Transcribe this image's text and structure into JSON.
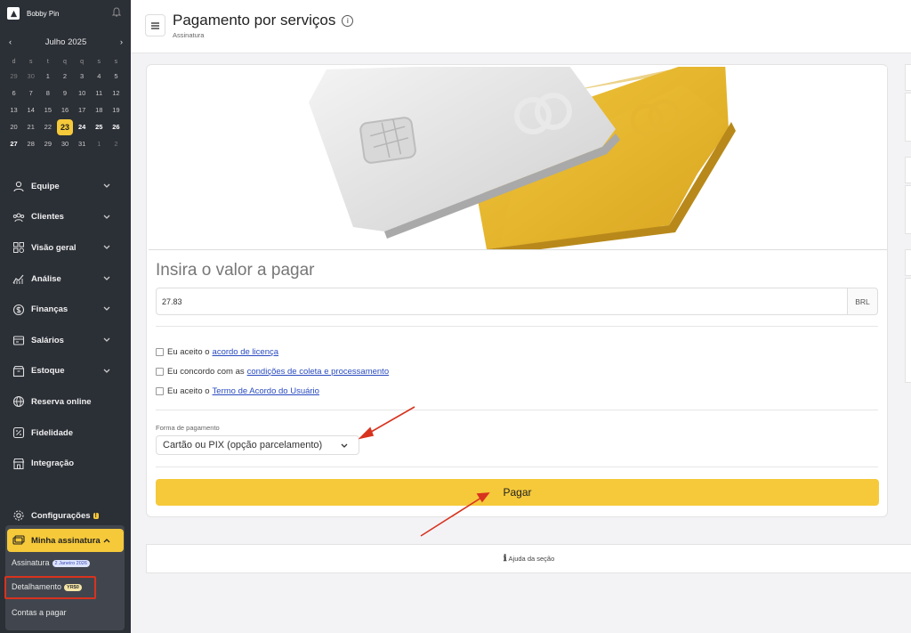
{
  "sidebar": {
    "brand": "Bobby Pin",
    "calendar": {
      "month": "Julho 2025",
      "prev": "‹",
      "next": "›",
      "weekdays": [
        "d",
        "s",
        "t",
        "q",
        "q",
        "s",
        "s"
      ],
      "weeks": [
        [
          "29",
          "30",
          "1",
          "2",
          "3",
          "4",
          "5"
        ],
        [
          "6",
          "7",
          "8",
          "9",
          "10",
          "11",
          "12"
        ],
        [
          "13",
          "14",
          "15",
          "16",
          "17",
          "18",
          "19"
        ],
        [
          "20",
          "21",
          "22",
          "23",
          "24",
          "25",
          "26"
        ],
        [
          "27",
          "28",
          "29",
          "30",
          "31",
          "1",
          "2"
        ]
      ],
      "today": "23"
    },
    "menu": [
      {
        "label": "Equipe",
        "icon": "user-icon",
        "chevron": true
      },
      {
        "label": "Clientes",
        "icon": "users-icon",
        "chevron": true
      },
      {
        "label": "Visão geral",
        "icon": "grid-icon",
        "chevron": true
      },
      {
        "label": "Análise",
        "icon": "chart-icon",
        "chevron": true
      },
      {
        "label": "Finanças",
        "icon": "dollar-icon",
        "chevron": true
      },
      {
        "label": "Salários",
        "icon": "wallet-icon",
        "chevron": true
      },
      {
        "label": "Estoque",
        "icon": "box-icon",
        "chevron": true
      },
      {
        "label": "Reserva online",
        "icon": "globe-icon",
        "chevron": false
      },
      {
        "label": "Fidelidade",
        "icon": "percent-icon",
        "chevron": false
      },
      {
        "label": "Integração",
        "icon": "store-icon",
        "chevron": false
      }
    ],
    "config": {
      "label": "Configurações",
      "badge": "!"
    },
    "subscription": {
      "label": "Minha assinatura",
      "items": [
        {
          "label": "Assinatura",
          "pill": "2 Janeiro 2026"
        },
        {
          "label": "Detalhamento",
          "pill": "YR$0"
        },
        {
          "label": "Contas a pagar"
        }
      ]
    }
  },
  "header": {
    "title": "Pagamento por serviços",
    "subtitle": "Assinatura",
    "info": "i"
  },
  "form": {
    "amount_title": "Insira o valor a pagar",
    "amount_value": "27.83",
    "currency": "BRL",
    "checks": [
      {
        "text": "Eu aceito o",
        "link": "acordo de licença"
      },
      {
        "text": "Eu concordo com as",
        "link": "condições de coleta e processamento"
      },
      {
        "text": "Eu aceito o",
        "link": "Termo de Acordo do Usuário"
      }
    ],
    "payment_label": "Forma de pagamento",
    "payment_value": "Cartão ou PIX (opção parcelamento)",
    "pay_button": "Pagar"
  },
  "help": {
    "icon": "ℹ",
    "label": "Ajuda da seção"
  },
  "colors": {
    "accent": "#f5c93a",
    "sidebar": "#2b2f36",
    "annotation": "#d8331f",
    "link": "#2a4bbf"
  }
}
